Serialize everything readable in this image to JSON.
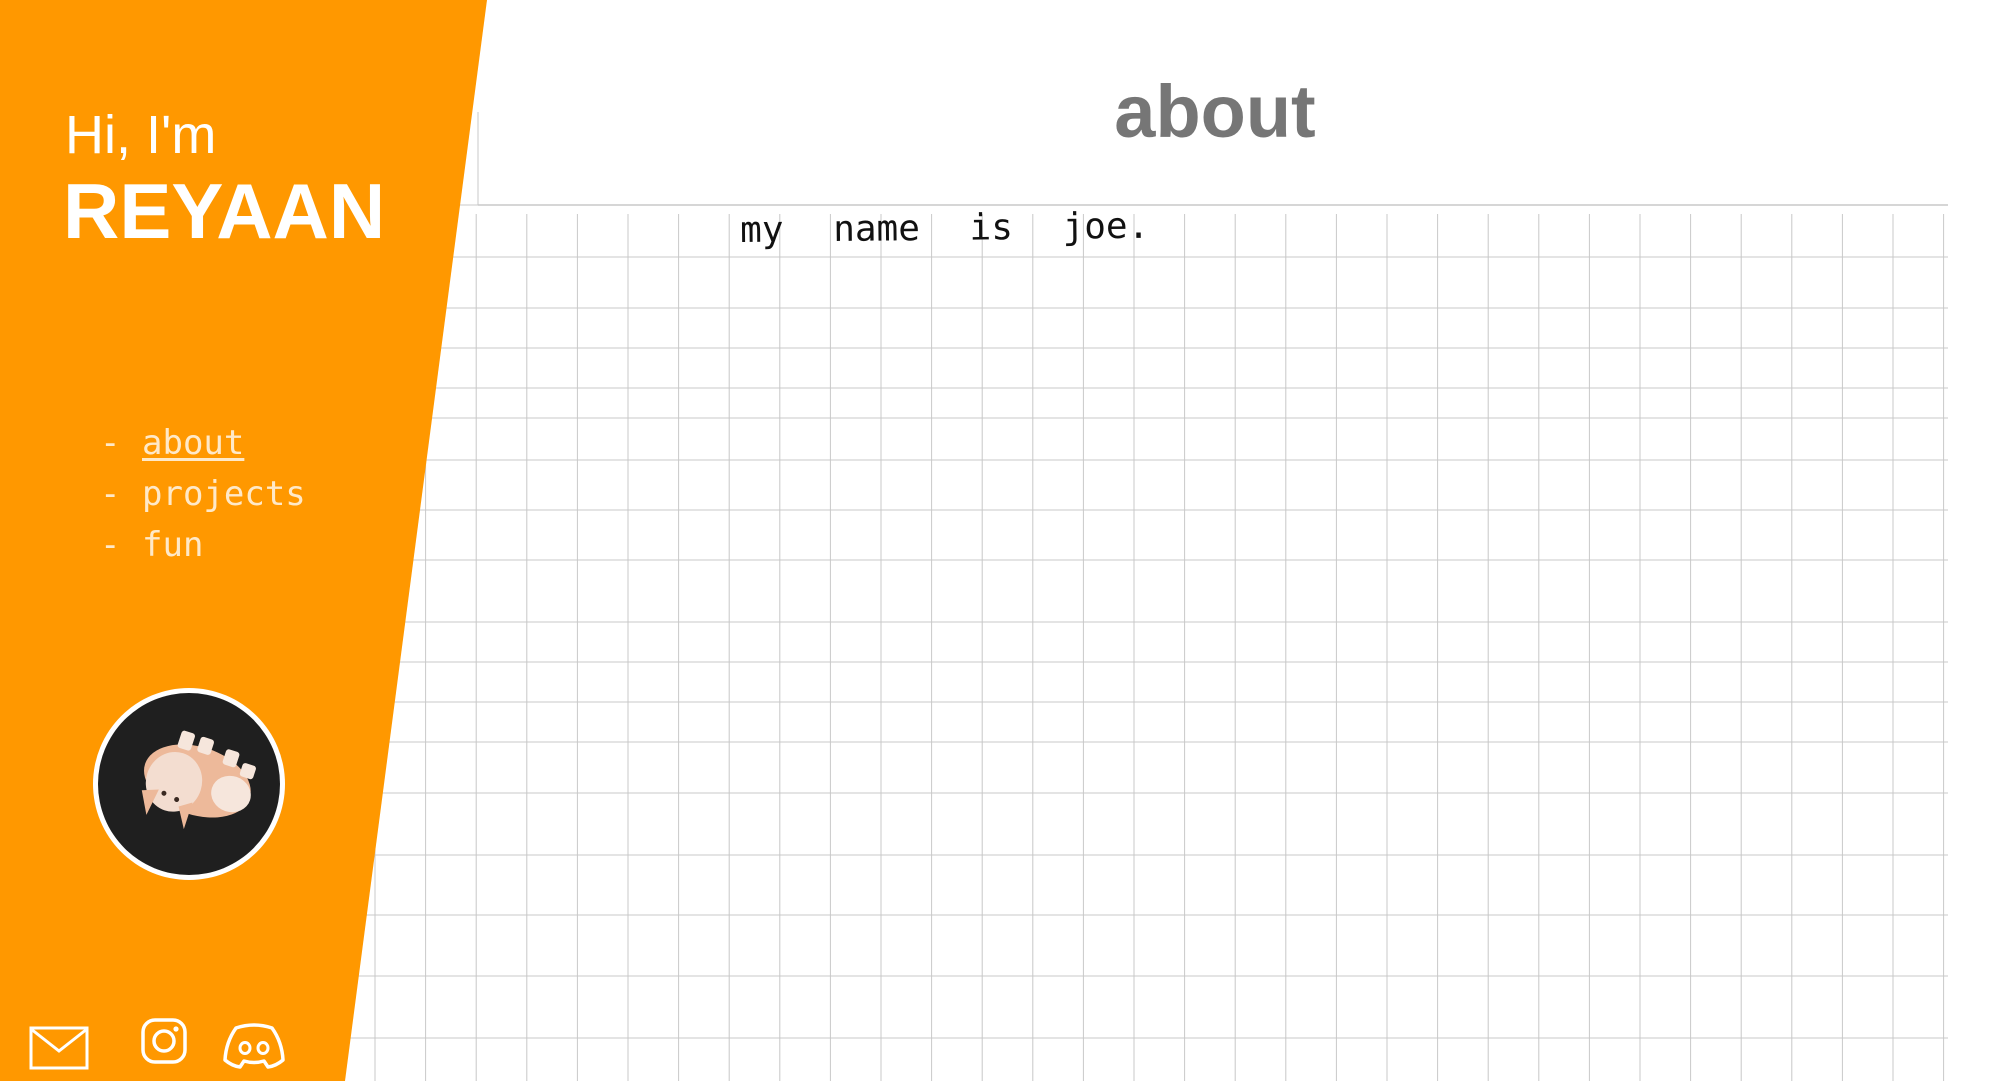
{
  "colors": {
    "sidebar": "#ff9800",
    "grid_line": "#c8c8c8",
    "title": "#767676",
    "nav_text": "#ffe9c8"
  },
  "sidebar": {
    "greeting": "Hi, I'm",
    "name": "REYAAN",
    "nav": [
      {
        "dash": "-",
        "label": "about",
        "active": true
      },
      {
        "dash": "-",
        "label": "projects",
        "active": false
      },
      {
        "dash": "-",
        "label": "fun",
        "active": false
      }
    ],
    "avatar_icon": "cartoon-pig-icon",
    "socials": [
      {
        "icon": "mail-icon"
      },
      {
        "icon": "instagram-icon"
      },
      {
        "icon": "discord-icon"
      }
    ]
  },
  "main": {
    "title": "about",
    "body": "my name is joe."
  }
}
